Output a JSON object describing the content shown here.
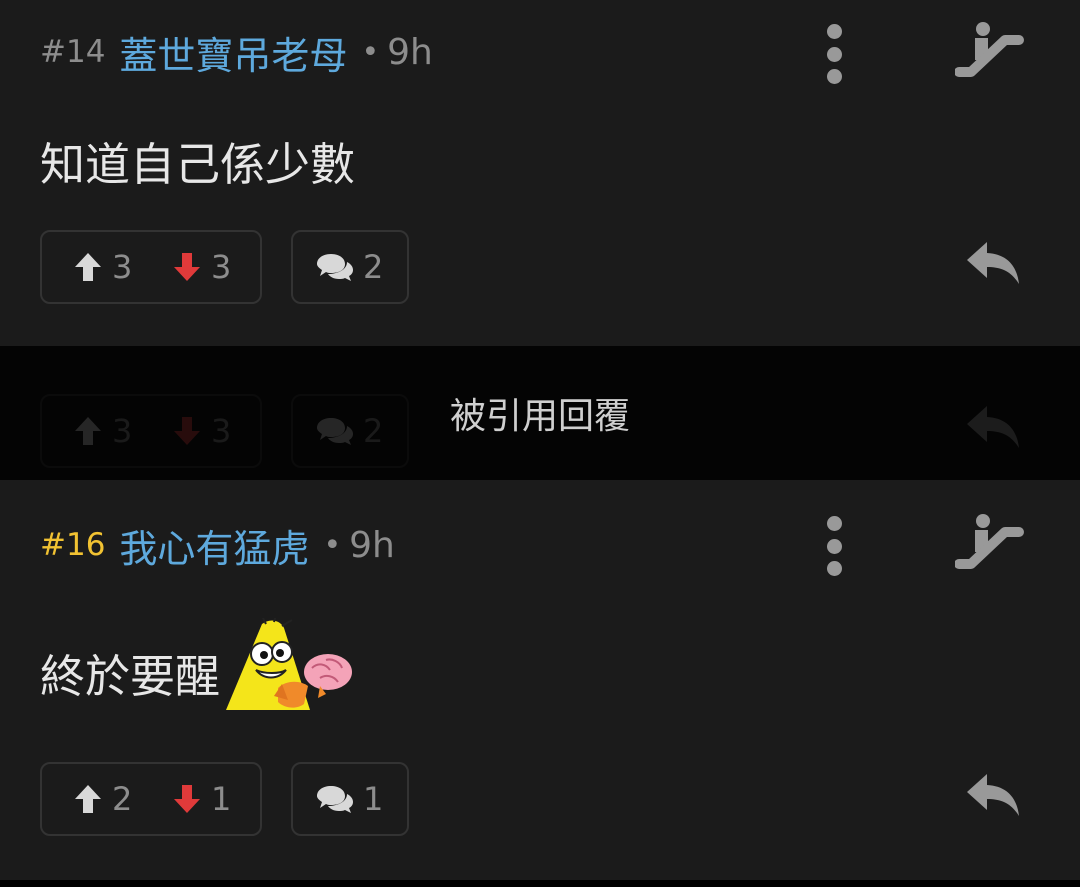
{
  "posts": [
    {
      "number": "#14",
      "username": "蓋世寶吊老母",
      "separator": "•",
      "time": "9h",
      "content": "知道自己係少數",
      "upvotes": "3",
      "downvotes": "3",
      "comments": "2"
    },
    {
      "number": "#16",
      "username": "我心有猛虎",
      "separator": "•",
      "time": "9h",
      "content": "終於要醒",
      "upvotes": "2",
      "downvotes": "1",
      "comments": "1"
    }
  ],
  "quoted_bar": {
    "label": "被引用回覆",
    "upvotes": "3",
    "downvotes": "3",
    "comments": "2"
  },
  "icons": {
    "more": "more-vertical-icon",
    "escalator": "escalator-icon",
    "upvote": "arrow-up-icon",
    "downvote": "arrow-down-icon",
    "comment": "comment-bubbles-icon",
    "reply": "reply-icon",
    "sticker": "sticker-emoji"
  },
  "colors": {
    "background": "#1b1b1b",
    "username": "#5ea9dd",
    "highlight_number": "#f1c232",
    "downvote_arrow": "#e03a3a",
    "muted": "#8d8d8d"
  }
}
